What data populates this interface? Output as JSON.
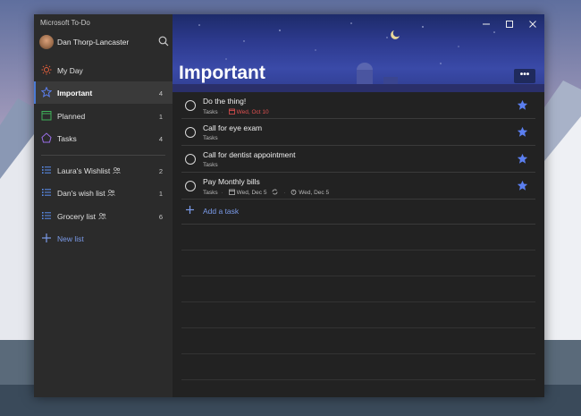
{
  "app": {
    "title": "Microsoft To-Do"
  },
  "user": {
    "name": "Dan Thorp-Lancaster"
  },
  "sidebar": {
    "smart_lists": [
      {
        "label": "My Day",
        "count": "",
        "icon": "sun-icon"
      },
      {
        "label": "Important",
        "count": "4",
        "icon": "star-icon"
      },
      {
        "label": "Planned",
        "count": "1",
        "icon": "calendar-icon"
      },
      {
        "label": "Tasks",
        "count": "4",
        "icon": "house-icon"
      }
    ],
    "lists": [
      {
        "label": "Laura's Wishlist",
        "count": "2",
        "shared": true
      },
      {
        "label": "Dan's wish list",
        "count": "1",
        "shared": true
      },
      {
        "label": "Grocery list",
        "count": "6",
        "shared": true
      }
    ],
    "new_list_label": "New list"
  },
  "header": {
    "title": "Important",
    "more_label": "•••"
  },
  "tasks": [
    {
      "title": "Do the thing!",
      "list": "Tasks",
      "due": "Wed, Oct 10",
      "due_overdue": true,
      "repeat": false,
      "reminder": ""
    },
    {
      "title": "Call for eye exam",
      "list": "Tasks",
      "due": "",
      "repeat": false,
      "reminder": ""
    },
    {
      "title": "Call for dentist appointment",
      "list": "Tasks",
      "due": "",
      "repeat": false,
      "reminder": ""
    },
    {
      "title": "Pay Monthly bills",
      "list": "Tasks",
      "due": "Wed, Dec 5",
      "due_overdue": false,
      "repeat": true,
      "reminder": "Wed, Dec 5"
    }
  ],
  "add_task_label": "Add a task",
  "colors": {
    "accent": "#4a7ad4",
    "star": "#5b7ff0",
    "overdue": "#e05050",
    "link": "#7a9ae8"
  }
}
